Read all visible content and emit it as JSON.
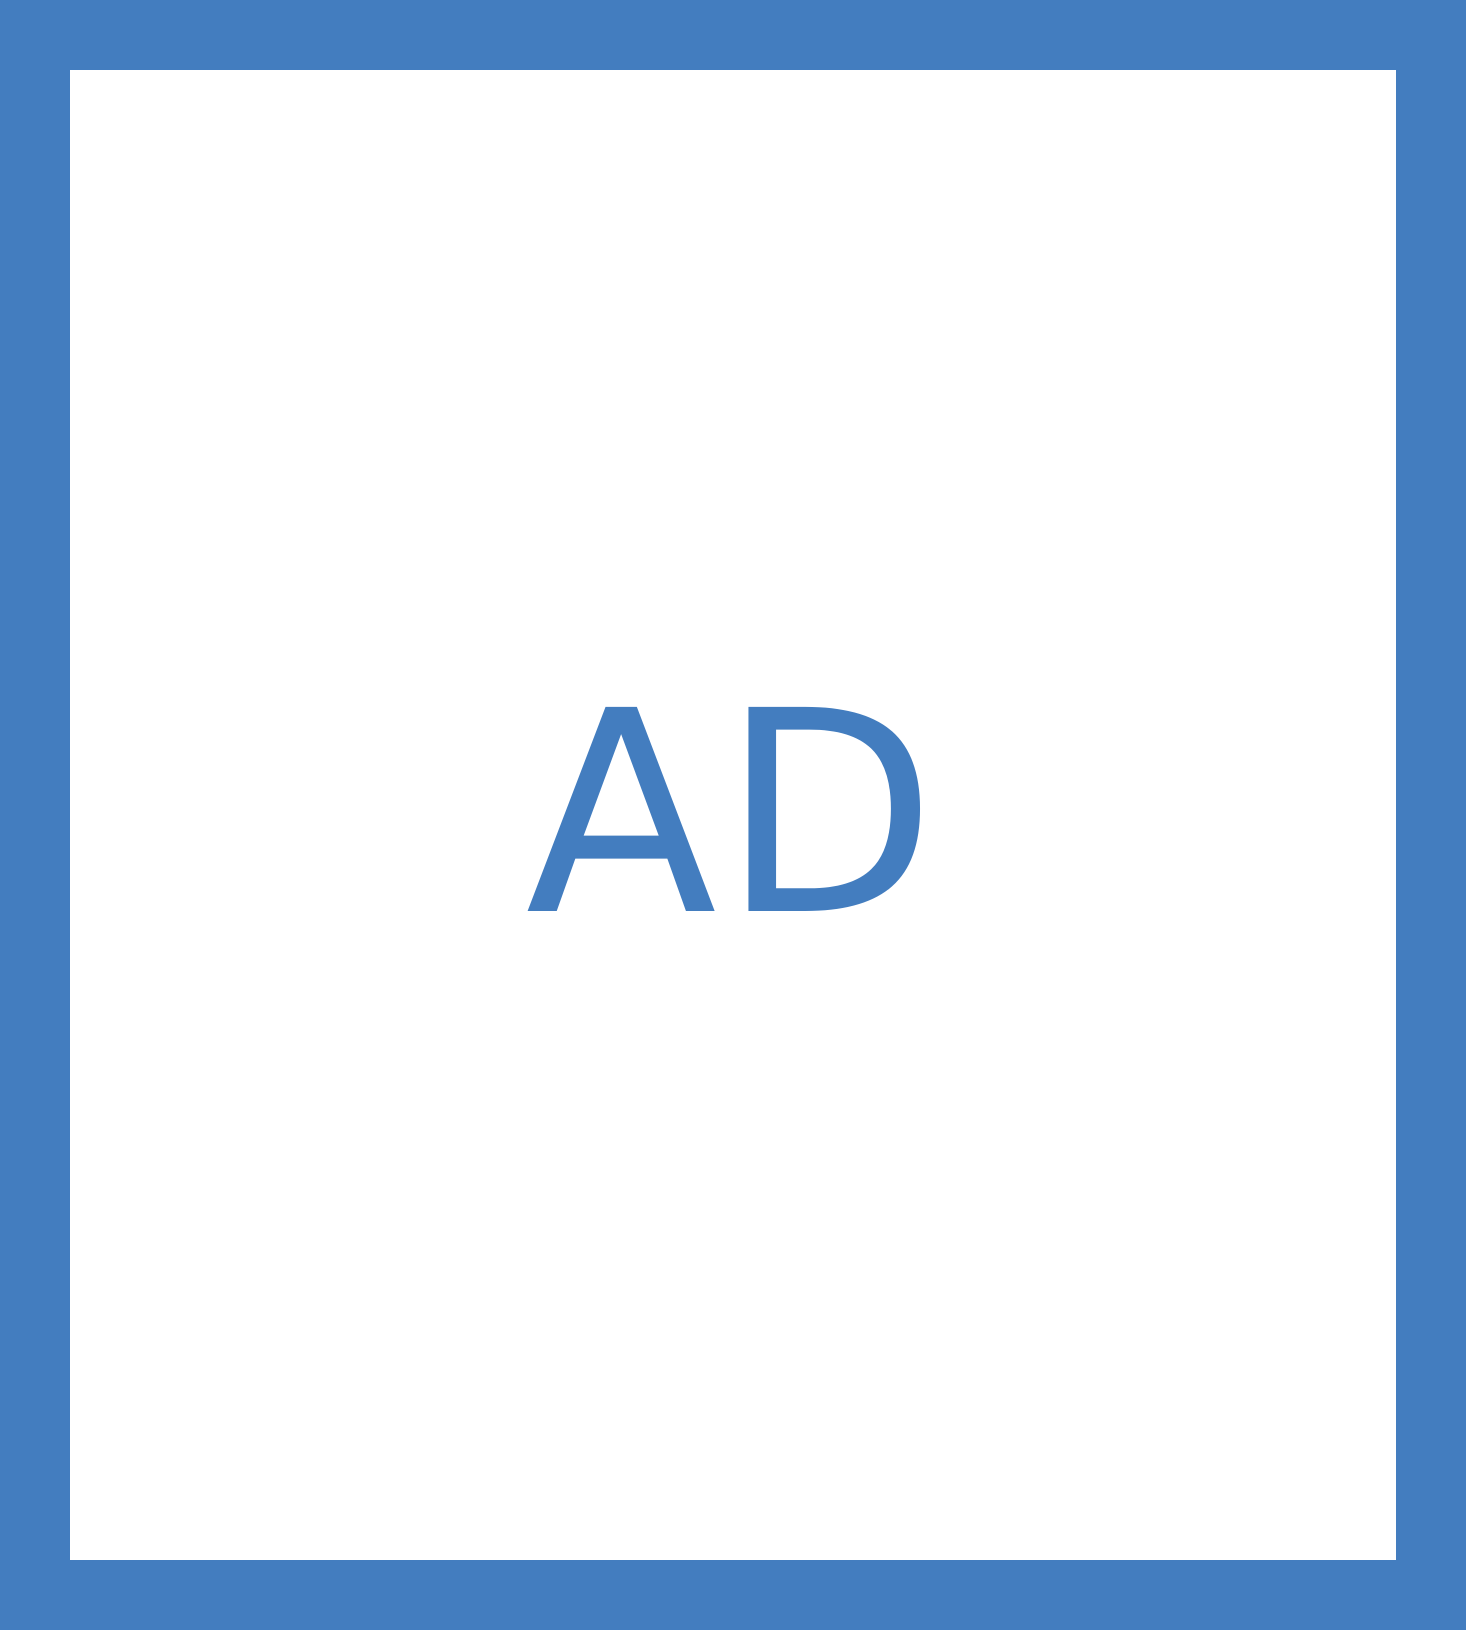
{
  "ad": {
    "label": "AD"
  },
  "colors": {
    "frame": "#437DBF",
    "text": "#437DBF",
    "background": "#FFFFFF"
  }
}
